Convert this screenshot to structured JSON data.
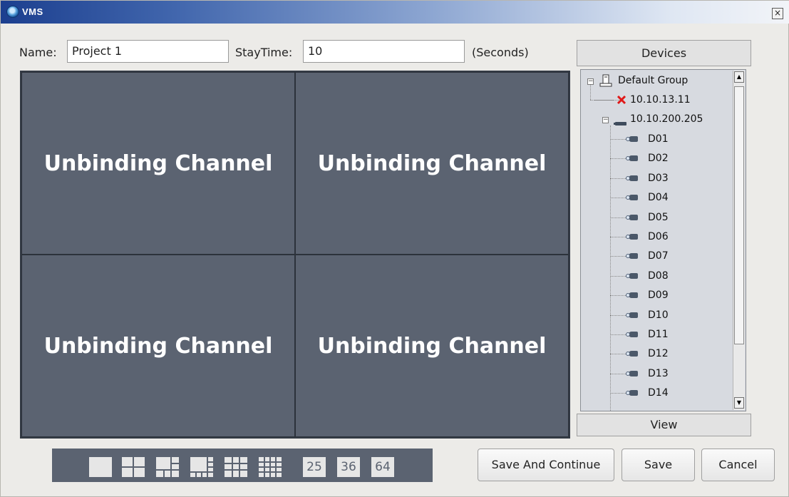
{
  "window": {
    "title": "VMS",
    "close_glyph": "×"
  },
  "form": {
    "name_label": "Name:",
    "name_value": "Project 1",
    "staytime_label": "StayTime:",
    "staytime_value": "10",
    "units_label": "(Seconds)"
  },
  "grid": {
    "cells": [
      "Unbinding Channel",
      "Unbinding Channel",
      "Unbinding Channel",
      "Unbinding Channel"
    ],
    "background_color": "#5b6371"
  },
  "devices_panel": {
    "header": "Devices",
    "footer": "View",
    "tree": {
      "group": "Default Group",
      "devices": [
        {
          "label": "10.10.13.11",
          "status": "offline",
          "icon": "error-x-icon"
        },
        {
          "label": "10.10.200.205",
          "status": "online",
          "icon": "nvr-icon",
          "channels": [
            "D01",
            "D02",
            "D03",
            "D04",
            "D05",
            "D06",
            "D07",
            "D08",
            "D09",
            "D10",
            "D11",
            "D12",
            "D13",
            "D14"
          ]
        }
      ]
    }
  },
  "layouts": {
    "icons": [
      "layout-1-icon",
      "layout-4-icon",
      "layout-6-icon",
      "layout-8-icon",
      "layout-9-icon",
      "layout-16-icon"
    ],
    "numbers": [
      "25",
      "36",
      "64"
    ]
  },
  "buttons": {
    "save_continue": "Save And Continue",
    "save": "Save",
    "cancel": "Cancel"
  }
}
